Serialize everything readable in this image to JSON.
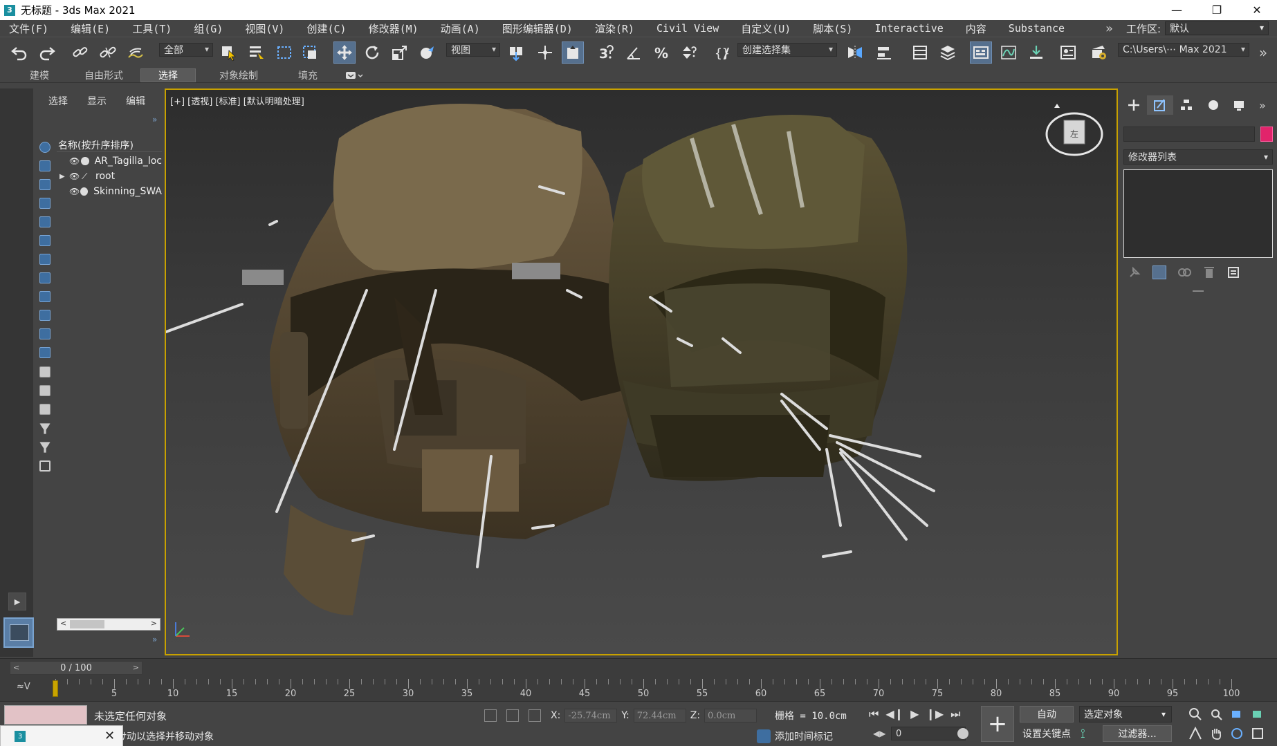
{
  "window": {
    "title": "无标题 - 3ds Max 2021",
    "app_icon_letter": "3",
    "controls": {
      "minimize": "—",
      "restore": "❐",
      "close": "✕"
    }
  },
  "menu": {
    "items": [
      "文件(F)",
      "编辑(E)",
      "工具(T)",
      "组(G)",
      "视图(V)",
      "创建(C)",
      "修改器(M)",
      "动画(A)",
      "图形编辑器(D)",
      "渲染(R)",
      "Civil View",
      "自定义(U)",
      "脚本(S)",
      "Interactive",
      "内容",
      "Substance"
    ],
    "more": "»",
    "workspace_label": "工作区:",
    "workspace_value": "默认"
  },
  "toolbar": {
    "selection_filter": "全部",
    "reference_coord": "视图",
    "named_selection": "创建选择集",
    "project_path": "C:\\Users\\⋯ Max 2021",
    "more": "»"
  },
  "ribbon": {
    "tabs": [
      "建模",
      "自由形式",
      "选择",
      "对象绘制",
      "填充"
    ],
    "active_tab": "选择"
  },
  "explorer": {
    "tabs": [
      "选择",
      "显示",
      "编辑"
    ],
    "column_header": "名称(按升序排序)",
    "rows": [
      {
        "name": "AR_Tagilla_loc",
        "expanded": false
      },
      {
        "name": "root",
        "expanded": true
      },
      {
        "name": "Skinning_SWA",
        "expanded": false
      }
    ],
    "scroll_left": "<",
    "scroll_right": ">"
  },
  "viewport": {
    "label": "[+] [透视] [标准] [默认明暗处理]",
    "viewcube_face": "左"
  },
  "command_panel": {
    "modifier_list": "修改器列表",
    "color_swatch": "#e1246b"
  },
  "timeline": {
    "frame_display": "0 / 100",
    "prev": "<",
    "next": ">",
    "current_frame": 0,
    "ticks": [
      5,
      10,
      15,
      20,
      25,
      30,
      35,
      40,
      45,
      50,
      55,
      60,
      65,
      70,
      75,
      80,
      85,
      90,
      95,
      100
    ]
  },
  "status": {
    "selection": "未选定任何对象",
    "prompt": "ﾅ动以选择并移动对象",
    "x_label": "X:",
    "x_value": "-25.74cm",
    "y_label": "Y:",
    "y_value": "72.44cm",
    "z_label": "Z:",
    "z_value": "0.0cm",
    "grid": "栅格 = 10.0cm",
    "add_time_tag": "添加时间标记",
    "auto_key": "自动",
    "set_key": "设置关键点",
    "selected_object": "选定对象",
    "filters": "过滤器...",
    "frame_field": "0"
  }
}
